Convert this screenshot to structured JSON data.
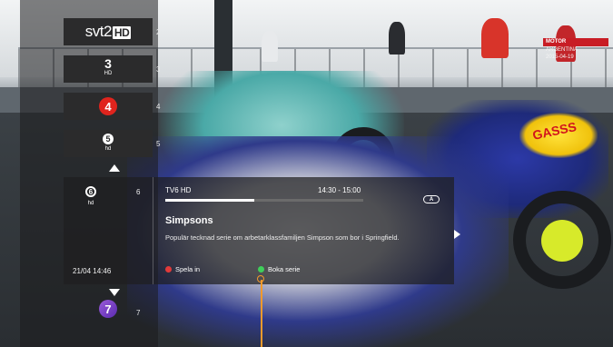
{
  "channels": [
    {
      "num": "2",
      "logo_text": "svt2",
      "logo_badge": "HD"
    },
    {
      "num": "3",
      "logo_text": "3",
      "logo_sub": "HD"
    },
    {
      "num": "4",
      "logo_text": "4"
    },
    {
      "num": "5",
      "logo_text": "5",
      "logo_sub": "hd"
    },
    {
      "num": "6",
      "logo_text": "6",
      "logo_sub": "hd"
    },
    {
      "num": "7",
      "logo_text": "7"
    }
  ],
  "info": {
    "datetime": "21/04  14:46",
    "channel_name": "TV6 HD",
    "time_range": "14:30 - 15:00",
    "progress": 0.45,
    "audio_badge": "A",
    "title": "Simpsons",
    "description": "Populär tecknad serie om arbetarklassfamiljen Simpson som bor i Springfield.",
    "record_label": "Spela in",
    "book_series_label": "Boka serie"
  },
  "corner": {
    "line1": "MOTOR",
    "line2": "ARGENTINA",
    "line3": "2015-04-19"
  },
  "colors": {
    "record": "#e23a3a",
    "book": "#3fcf5a",
    "focus": "#f39a2b"
  }
}
